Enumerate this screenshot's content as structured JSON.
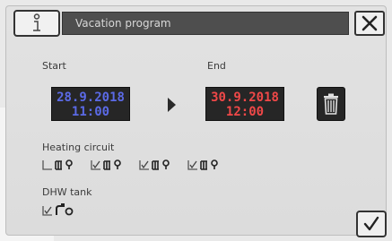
{
  "dialog": {
    "title": "Vacation program",
    "start_label": "Start",
    "end_label": "End",
    "start_date": "28.9.2018",
    "start_time": "11:00",
    "end_date": "30.9.2018",
    "end_time": "12:00",
    "heating_label": "Heating circuit",
    "dhw_label": "DHW tank"
  },
  "heating_circuits": [
    {
      "id": "1",
      "checked": false
    },
    {
      "id": "2",
      "checked": true
    },
    {
      "id": "3",
      "checked": true
    },
    {
      "id": "4",
      "checked": true
    }
  ],
  "dhw": {
    "checked": true
  },
  "icons": {
    "info": "info-icon",
    "close": "close-icon",
    "trash": "trash-icon",
    "arrow": "arrow-right-icon",
    "confirm": "checkmark-icon",
    "heating": "radiator-icon",
    "dhw": "tap-icon"
  },
  "colors": {
    "start_text": "#5b6ae6",
    "end_text": "#f04848",
    "title_bg": "#4e4e4e"
  }
}
